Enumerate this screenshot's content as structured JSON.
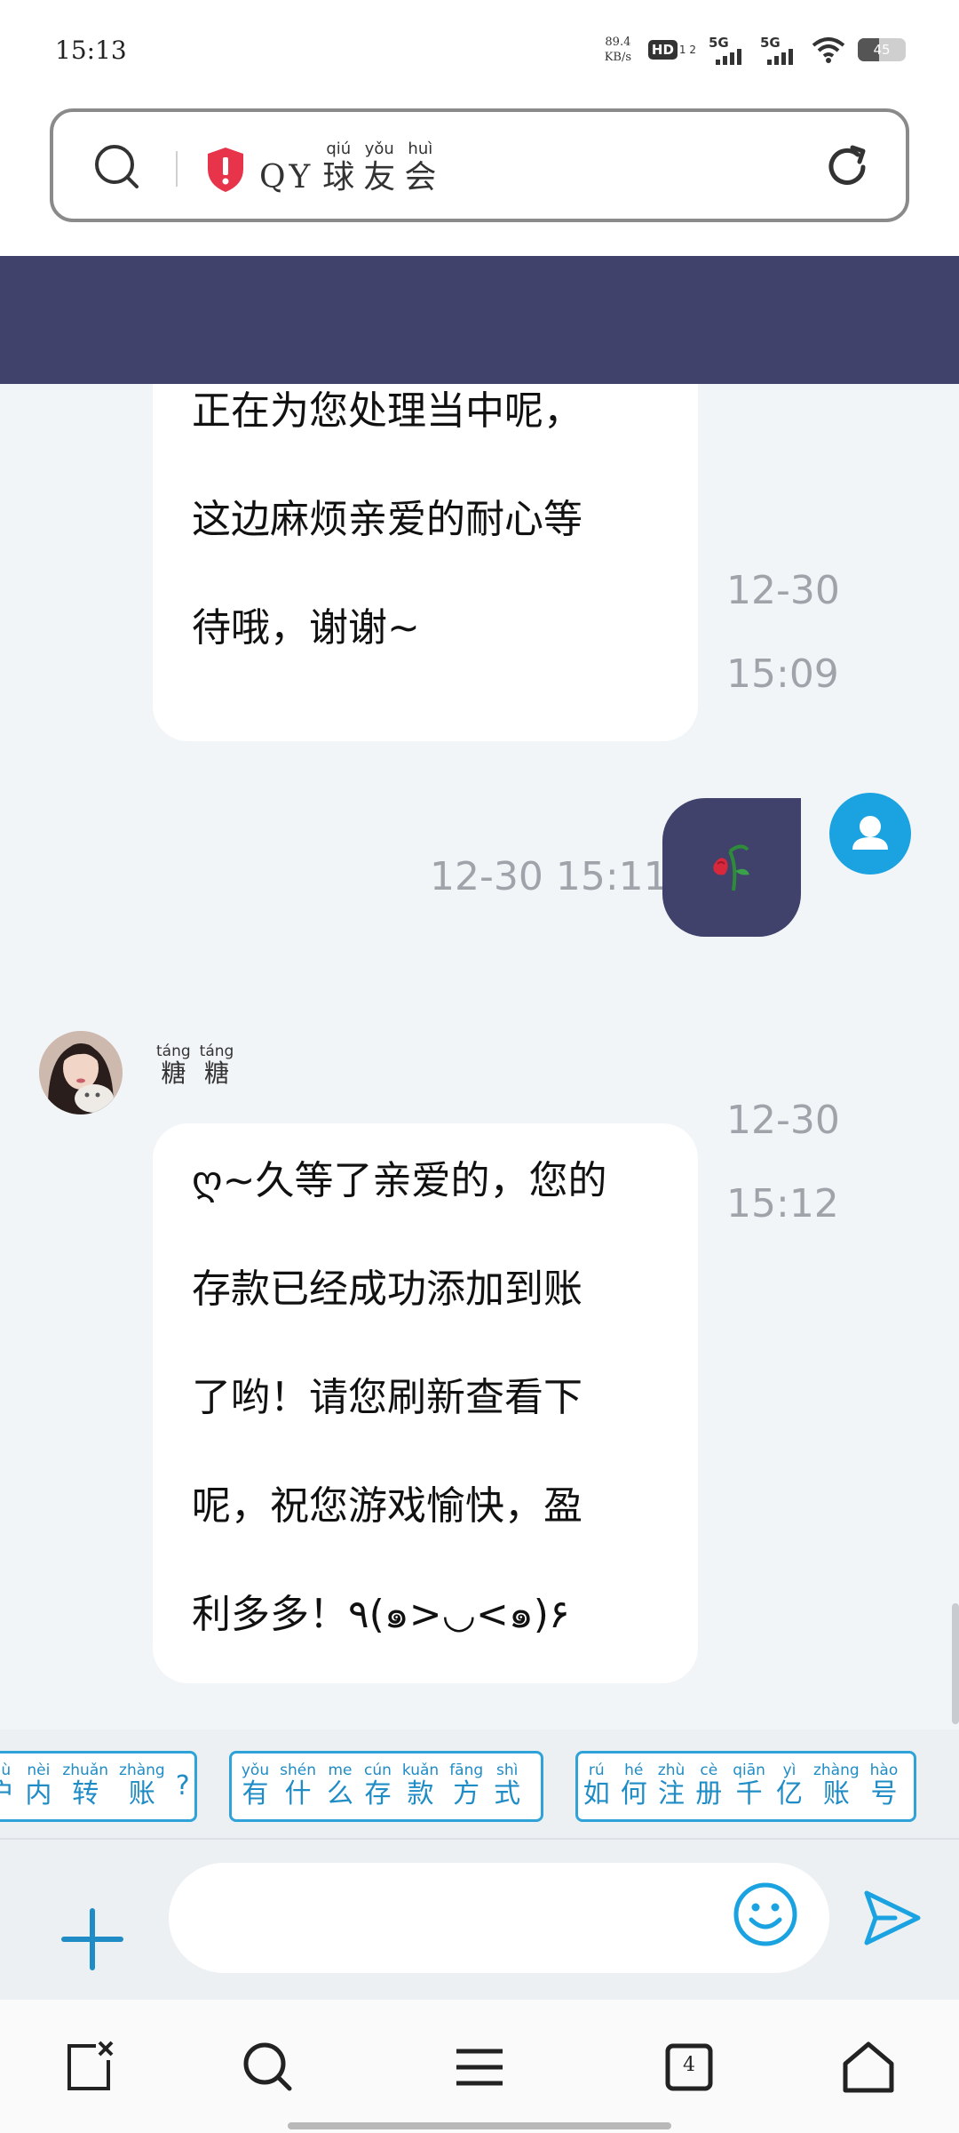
{
  "status_bar": {
    "time": "15:13",
    "net_speed_value": "89.4",
    "net_speed_unit": "KB/s",
    "hd_label": "HD",
    "hd_sub": "1 2",
    "signal_1_label": "5G",
    "signal_2_label": "5G",
    "battery_percent": "45",
    "battery_level": 0.45
  },
  "url_bar": {
    "title_latin": "QY",
    "title_chars": [
      {
        "pinyin": "qiú",
        "hanzi": "球"
      },
      {
        "pinyin": "yǒu",
        "hanzi": "友"
      },
      {
        "pinyin": "huì",
        "hanzi": "会"
      }
    ]
  },
  "messages": {
    "m1": {
      "lines": [
        "正在为您处理当中呢，",
        "这边麻烦亲爱的耐心等",
        "待哦，谢谢~"
      ],
      "date": "12-30",
      "time": "15:09"
    },
    "m2": {
      "timestamp": "12-30 15:11",
      "sticker": "rose-sticker"
    },
    "agent_name": [
      {
        "pinyin": "táng",
        "hanzi": "糖"
      },
      {
        "pinyin": "táng",
        "hanzi": "糖"
      }
    ],
    "m3": {
      "lines": [
        "ღ~久等了亲爱的，您的",
        "存款已经成功添加到账",
        "了哟！请您刷新查看下",
        "呢，祝您游戏愉快，盈",
        "利多多！٩(๑>◡<๑)۶"
      ],
      "date": "12-30",
      "time": "15:12"
    }
  },
  "quick_replies": [
    [
      {
        "pinyin": "hù",
        "hanzi": "户"
      },
      {
        "pinyin": "nèi",
        "hanzi": "内"
      },
      {
        "pinyin": "zhuǎn",
        "hanzi": "转"
      },
      {
        "pinyin": "zhàng",
        "hanzi": "账"
      },
      {
        "pinyin": "",
        "hanzi": "?"
      }
    ],
    [
      {
        "pinyin": "yǒu",
        "hanzi": "有"
      },
      {
        "pinyin": "shén",
        "hanzi": "什"
      },
      {
        "pinyin": "me",
        "hanzi": "么"
      },
      {
        "pinyin": "cún",
        "hanzi": "存"
      },
      {
        "pinyin": "kuǎn",
        "hanzi": "款"
      },
      {
        "pinyin": "fāng",
        "hanzi": "方"
      },
      {
        "pinyin": "shì",
        "hanzi": "式"
      }
    ],
    [
      {
        "pinyin": "rú",
        "hanzi": "如"
      },
      {
        "pinyin": "hé",
        "hanzi": "何"
      },
      {
        "pinyin": "zhù",
        "hanzi": "注"
      },
      {
        "pinyin": "cè",
        "hanzi": "册"
      },
      {
        "pinyin": "qiān",
        "hanzi": "千"
      },
      {
        "pinyin": "yì",
        "hanzi": "亿"
      },
      {
        "pinyin": "zhàng",
        "hanzi": "账"
      },
      {
        "pinyin": "hào",
        "hanzi": "号"
      }
    ]
  ],
  "composer": {
    "input_value": "",
    "input_placeholder": ""
  },
  "browser_nav": {
    "tabs_count": "4"
  },
  "colors": {
    "header_purple": "#40426b",
    "accent_blue": "#1f8cc6",
    "chat_bg": "#f2f5f8",
    "shield_red": "#e8344a"
  },
  "icons": [
    "search-icon",
    "shield-alert-icon",
    "refresh-icon",
    "user-icon",
    "plus-icon",
    "emoji-icon",
    "send-icon",
    "close-tab-icon",
    "search-icon",
    "menu-icon",
    "tabs-icon",
    "home-icon"
  ]
}
